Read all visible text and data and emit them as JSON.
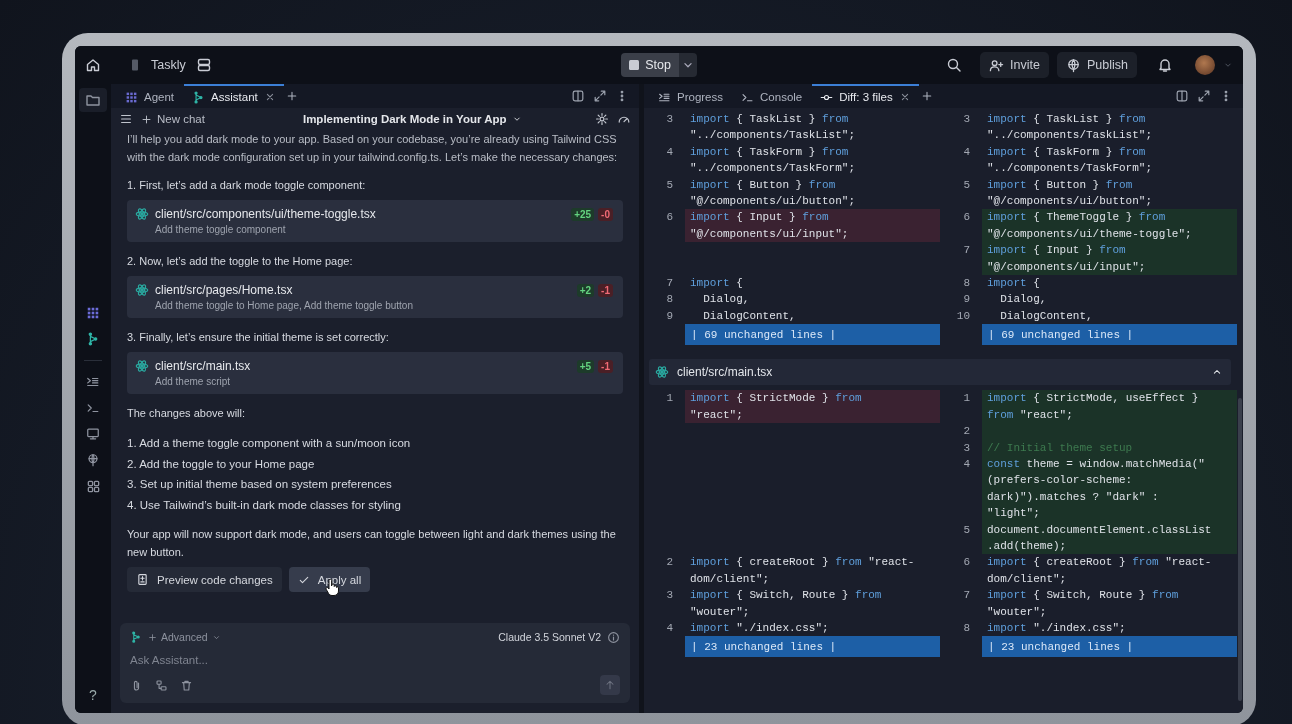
{
  "top_bar": {
    "project": "Taskly",
    "stop_button": "Stop",
    "invite_button": "Invite",
    "publish_button": "Publish"
  },
  "sidebar": {
    "help": "?"
  },
  "left_panel": {
    "tabs": [
      {
        "label": "Agent",
        "kind": "agent",
        "selected": false
      },
      {
        "label": "Assistant",
        "kind": "assistant",
        "selected": true
      }
    ],
    "new_chat": "New chat",
    "chat_title": "Implementing Dark Mode in Your App",
    "messages": [
      {
        "kind": "paragraph",
        "text": "I’ll help you add dark mode to your app. Based on your codebase, you’re already using Tailwind CSS with the dark mode configuration set up in your tailwind.config.ts. Let’s make the necessary changes:"
      },
      {
        "kind": "paragraph",
        "text": "1. First, let’s add a dark mode toggle component:"
      },
      {
        "kind": "file",
        "path": "client/src/components/ui/theme-toggle.tsx",
        "summary": "Add theme toggle component",
        "added": "+25",
        "removed": "-0"
      },
      {
        "kind": "paragraph",
        "text": "2. Now, let’s add the toggle to the Home page:"
      },
      {
        "kind": "file",
        "path": "client/src/pages/Home.tsx",
        "summary": "Add theme toggle to Home page, Add theme toggle button",
        "added": "+2",
        "removed": "-1"
      },
      {
        "kind": "paragraph",
        "text": "3. Finally, let’s ensure the initial theme is set correctly:"
      },
      {
        "kind": "file",
        "path": "client/src/main.tsx",
        "summary": "Add theme script",
        "added": "+5",
        "removed": "-1"
      },
      {
        "kind": "paragraph",
        "text": "The changes above will:"
      },
      {
        "kind": "list",
        "items": [
          "1. Add a theme toggle component with a sun/moon icon",
          "2. Add the toggle to your Home page",
          "3. Set up initial theme based on system preferences",
          "4. Use Tailwind’s built-in dark mode classes for styling"
        ]
      },
      {
        "kind": "paragraph",
        "text": "Your app will now support dark mode, and users can toggle between light and dark themes using the new button."
      }
    ],
    "actions": [
      {
        "label": "Preview code changes",
        "kind": "preview",
        "hovered": false
      },
      {
        "label": "Apply all",
        "kind": "apply",
        "hovered": true
      }
    ],
    "composer": {
      "mode": "Advanced",
      "model": "Claude 3.5 Sonnet V2",
      "placeholder": "Ask Assistant..."
    }
  },
  "diff_panel": {
    "tabs": [
      {
        "label": "Progress",
        "kind": "progress",
        "selected": false
      },
      {
        "label": "Console",
        "kind": "console",
        "selected": false
      },
      {
        "label": "Diff: 3 files",
        "kind": "diff",
        "selected": true
      }
    ],
    "hunks": [
      {
        "rows": [
          {
            "left": {
              "num": "3",
              "added": false,
              "removed": false,
              "code": [
                "import { TaskList } from",
                "\"../components/TaskList\";"
              ]
            },
            "right": {
              "num": "3",
              "added": false,
              "removed": false,
              "code": [
                "import { TaskList } from",
                "\"../components/TaskList\";"
              ]
            }
          },
          {
            "left": {
              "num": "4",
              "added": false,
              "removed": false,
              "code": [
                "import { TaskForm } from",
                "\"../components/TaskForm\";"
              ]
            },
            "right": {
              "num": "4",
              "added": false,
              "removed": false,
              "code": [
                "import { TaskForm } from",
                "\"../components/TaskForm\";"
              ]
            }
          },
          {
            "left": {
              "num": "5",
              "added": false,
              "removed": false,
              "code": [
                "import { Button } from",
                "\"@/components/ui/button\";"
              ]
            },
            "right": {
              "num": "5",
              "added": false,
              "removed": false,
              "code": [
                "import { Button } from",
                "\"@/components/ui/button\";"
              ]
            }
          },
          {
            "left": {
              "num": "6",
              "added": false,
              "removed": true,
              "code": [
                "import { Input } from",
                "\"@/components/ui/input\";"
              ]
            },
            "right": {
              "num": "6",
              "added": true,
              "removed": false,
              "code": [
                "import { ThemeToggle } from",
                "\"@/components/ui/theme-toggle\";"
              ]
            }
          },
          {
            "right": {
              "num": "7",
              "added": true,
              "removed": false,
              "code": [
                "import { Input } from",
                "\"@/components/ui/input\";"
              ]
            }
          },
          {
            "left": {
              "num": "7",
              "added": false,
              "removed": false,
              "code": [
                "import {"
              ]
            },
            "right": {
              "num": "8",
              "added": false,
              "removed": false,
              "code": [
                "import {"
              ]
            }
          },
          {
            "left": {
              "num": "8",
              "added": false,
              "removed": false,
              "code": [
                "  Dialog,"
              ]
            },
            "right": {
              "num": "9",
              "added": false,
              "removed": false,
              "code": [
                "  Dialog,"
              ]
            }
          },
          {
            "left": {
              "num": "9",
              "added": false,
              "removed": false,
              "code": [
                "  DialogContent,"
              ]
            },
            "right": {
              "num": "10",
              "added": false,
              "removed": false,
              "code": [
                "  DialogContent,"
              ]
            }
          }
        ],
        "collapsed": {
          "left": "| 69 unchanged lines |",
          "right": "| 69 unchanged lines |"
        }
      },
      {
        "file": "client/src/main.tsx",
        "rows": [
          {
            "left": {
              "num": "1",
              "added": false,
              "removed": true,
              "code": [
                "import { StrictMode } from",
                "\"react\";"
              ]
            },
            "right": {
              "num": "1",
              "added": true,
              "removed": false,
              "code": [
                "import { StrictMode, useEffect }",
                "from \"react\";"
              ]
            }
          },
          {
            "right": {
              "num": "2",
              "added": true,
              "removed": false
            }
          },
          {
            "right": {
              "num": "3",
              "added": true,
              "removed": false,
              "code": [
                "// Initial theme setup"
              ]
            }
          },
          {
            "right": {
              "num": "4",
              "added": true,
              "removed": false,
              "code": [
                "const theme = window.matchMedia(\"",
                "(prefers-color-scheme:",
                "dark)\").matches ? \"dark\" :",
                "\"light\";"
              ]
            }
          },
          {
            "right": {
              "num": "5",
              "added": true,
              "removed": false,
              "code": [
                "document.documentElement.classList",
                ".add(theme);"
              ]
            }
          },
          {
            "left": {
              "num": "2",
              "added": false,
              "removed": false,
              "code": [
                "import { createRoot } from \"react-",
                "dom/client\";"
              ]
            },
            "right": {
              "num": "6",
              "added": false,
              "removed": false,
              "code": [
                "import { createRoot } from \"react-",
                "dom/client\";"
              ]
            }
          },
          {
            "left": {
              "num": "3",
              "added": false,
              "removed": false,
              "code": [
                "import { Switch, Route } from",
                "\"wouter\";"
              ]
            },
            "right": {
              "num": "7",
              "added": false,
              "removed": false,
              "code": [
                "import { Switch, Route } from",
                "\"wouter\";"
              ]
            }
          },
          {
            "left": {
              "num": "4",
              "added": false,
              "removed": false,
              "code": [
                "import \"./index.css\";"
              ]
            },
            "right": {
              "num": "8",
              "added": false,
              "removed": false,
              "code": [
                "import \"./index.css\";"
              ]
            }
          }
        ],
        "collapsed": {
          "left": "| 23 unchanged lines |",
          "right": "| 23 unchanged lines |"
        }
      }
    ]
  }
}
